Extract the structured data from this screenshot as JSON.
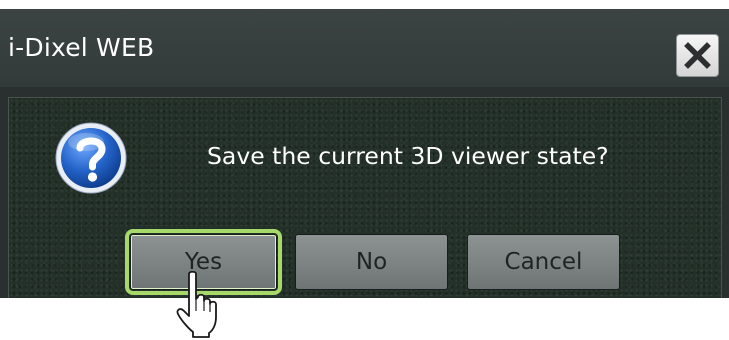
{
  "window": {
    "title": "i-Dixel WEB"
  },
  "dialog": {
    "message": "Save the current 3D viewer state?",
    "icon": "question-icon",
    "close_icon": "close-icon"
  },
  "buttons": {
    "yes": "Yes",
    "no": "No",
    "cancel": "Cancel"
  },
  "cursor": {
    "icon": "hand-pointer-icon",
    "target": "Yes"
  },
  "colors": {
    "title_bar": "#383f3f",
    "content_background": "#233028",
    "button_face": "#7f8585",
    "focus_outline": "#a6d86a",
    "icon_blue": "#1f5fb8",
    "text": "#ffffff"
  }
}
